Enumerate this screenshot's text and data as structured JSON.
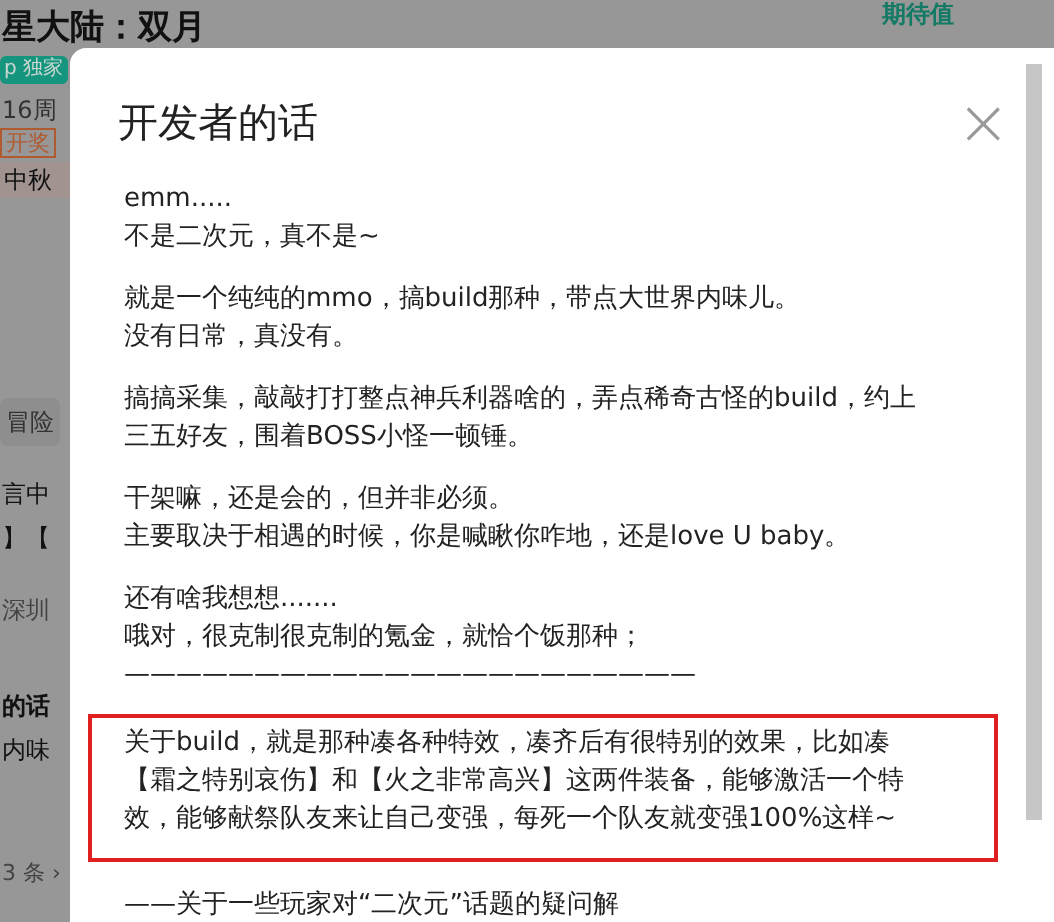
{
  "background_page": {
    "title": "星大陆：双月",
    "rating_label": "期待值",
    "badge": "p 独家",
    "age": "16周",
    "award": "开奖",
    "banner": "中秋",
    "tag": "冒险",
    "lines": [
      {
        "kind": "text",
        "text": "言中"
      },
      {
        "kind": "text",
        "text": "】【"
      },
      {
        "kind": "muted",
        "text": "深圳"
      },
      {
        "kind": "bold",
        "text": "的话"
      },
      {
        "kind": "text",
        "text": "内味"
      }
    ],
    "more": "3 条 ›"
  },
  "dialog": {
    "title": "开发者的话",
    "close": "×",
    "paragraphs": [
      {
        "highlighted": false,
        "lines": [
          "emm.....",
          "不是二次元，真不是~"
        ]
      },
      {
        "highlighted": false,
        "lines": [
          "就是一个纯纯的mmo，搞build那种，带点大世界内味儿。",
          "没有日常，真没有。"
        ]
      },
      {
        "highlighted": false,
        "lines": [
          "搞搞采集，敲敲打打整点神兵利器啥的，弄点稀奇古怪的build，约上",
          "三五好友，围着BOSS小怪一顿锤。"
        ]
      },
      {
        "highlighted": false,
        "lines": [
          "干架嘛，还是会的，但并非必须。",
          "主要取决于相遇的时候，你是喊瞅你咋地，还是love U baby。"
        ]
      },
      {
        "highlighted": false,
        "lines": [
          "还有啥我想想.......",
          "哦对，很克制很克制的氪金，就恰个饭那种；",
          "——————————————————————"
        ]
      },
      {
        "highlighted": true,
        "lines": [
          "关于build，就是那种凑各种特效，凑齐后有很特别的效果，比如凑",
          "【霜之特别哀伤】和【火之非常高兴】这两件装备，能够激活一个特",
          "效，能够献祭队友来让自己变强，每死一个队友就变强100%这样~"
        ]
      },
      {
        "highlighted": false,
        "lines": [
          "——关于一些玩家对“二次元”话题的疑问解"
        ]
      }
    ]
  }
}
